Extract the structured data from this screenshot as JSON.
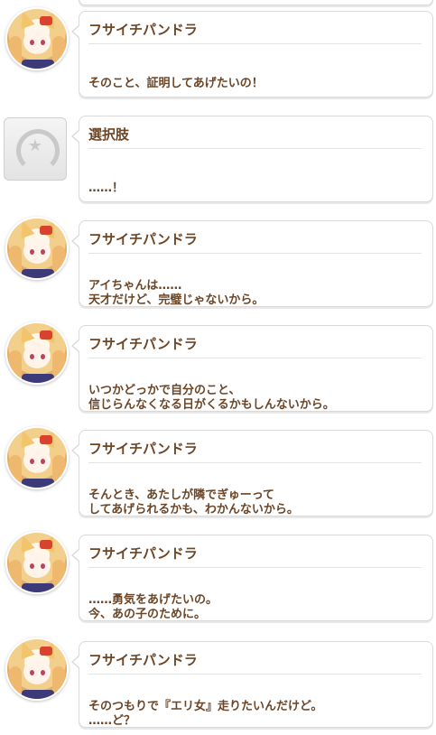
{
  "messages": [
    {
      "type": "character",
      "speaker": "フサイチパンドラ",
      "lines": [
        "そのこと、証明してあげたいの！"
      ]
    },
    {
      "type": "choice",
      "speaker": "選択肢",
      "lines": [
        "……！"
      ]
    },
    {
      "type": "character",
      "speaker": "フサイチパンドラ",
      "lines": [
        "アイちゃんは……",
        "天才だけど、完璧じゃないから。"
      ]
    },
    {
      "type": "character",
      "speaker": "フサイチパンドラ",
      "lines": [
        "いつかどっかで自分のこと、",
        "信じらんなくなる日がくるかもしんないから。"
      ]
    },
    {
      "type": "character",
      "speaker": "フサイチパンドラ",
      "lines": [
        "そんとき、あたしが隣でぎゅーって",
        "してあげられるかも、わかんないから。"
      ]
    },
    {
      "type": "character",
      "speaker": "フサイチパンドラ",
      "lines": [
        "……勇気をあげたいの。",
        "今、あの子のために。"
      ]
    },
    {
      "type": "character",
      "speaker": "フサイチパンドラ",
      "lines": [
        "そのつもりで『エリ女』走りたいんだけど。",
        "……ど？"
      ]
    }
  ],
  "colors": {
    "text": "#6b4526",
    "bubble_border": "#d9d9d9",
    "background": "#ffffff"
  }
}
